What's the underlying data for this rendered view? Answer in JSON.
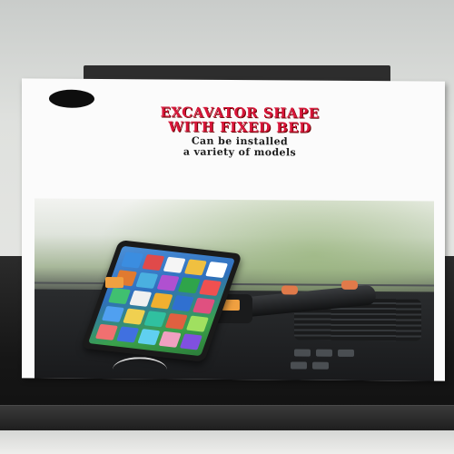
{
  "package": {
    "title_line1": "EXCAVATOR SHAPE",
    "title_line2": "WITH FIXED BED",
    "subtitle_line1": "Can be installed",
    "subtitle_line2": "a variety of models"
  },
  "colors": {
    "title": "#d9163a",
    "box": "#fbfbfb",
    "shelf": "#161616",
    "accent_orange": "#f0a040"
  },
  "tablet": {
    "app_colors": [
      "#3b8de0",
      "#e04a4a",
      "#f5f5f5",
      "#f0c040",
      "#ffffff",
      "#e07a30",
      "#4ab0e0",
      "#b050d0",
      "#2fa44a",
      "#f05050",
      "#40c070",
      "#f0f0f0",
      "#f0b030",
      "#3070d0",
      "#e05080",
      "#50a0f0",
      "#f0d050",
      "#30c0a0",
      "#e06040",
      "#a0e060",
      "#f07070",
      "#4070e0",
      "#60d0f0",
      "#f0a0c0",
      "#8050e0"
    ]
  }
}
